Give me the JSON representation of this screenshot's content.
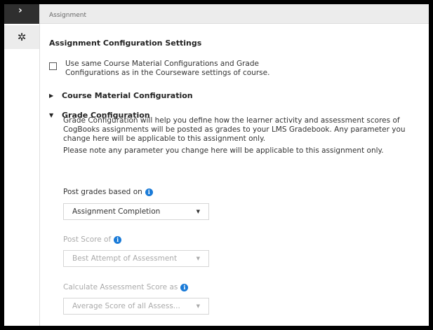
{
  "header": {
    "subtitle": "Assignment"
  },
  "rail": {
    "top_icon": "chevron-right-icon",
    "gear_icon": "gear-icon"
  },
  "section_title": "Assignment Configuration Settings",
  "checkbox": {
    "label": "Use same Course Material Configurations and Grade Configurations as in the Courseware settings of course.",
    "checked": false
  },
  "accordions": {
    "course_material": {
      "label": "Course Material Configuration",
      "expanded": false
    },
    "grade": {
      "label": "Grade Configuration",
      "expanded": true
    }
  },
  "grade": {
    "description": "Grade Configuration will help you define how the learner activity and assessment scores of CogBooks assignments will be posted as grades to your LMS Gradebook. Any parameter you change here will be applicable to this assignment only.",
    "note": "Please note any parameter you change here will be applicable to this assignment only.",
    "post_grades": {
      "label": "Post grades based on",
      "value": "Assignment Completion"
    },
    "post_score": {
      "label": "Post Score of",
      "value": "Best Attempt of Assessment"
    },
    "calc_score": {
      "label": "Calculate Assessment Score as",
      "value": "Average Score of all Assess..."
    }
  },
  "colors": {
    "info": "#1a7bd8",
    "disabled_text": "#aaaaaa",
    "rail_dark": "#2f2f2f"
  }
}
